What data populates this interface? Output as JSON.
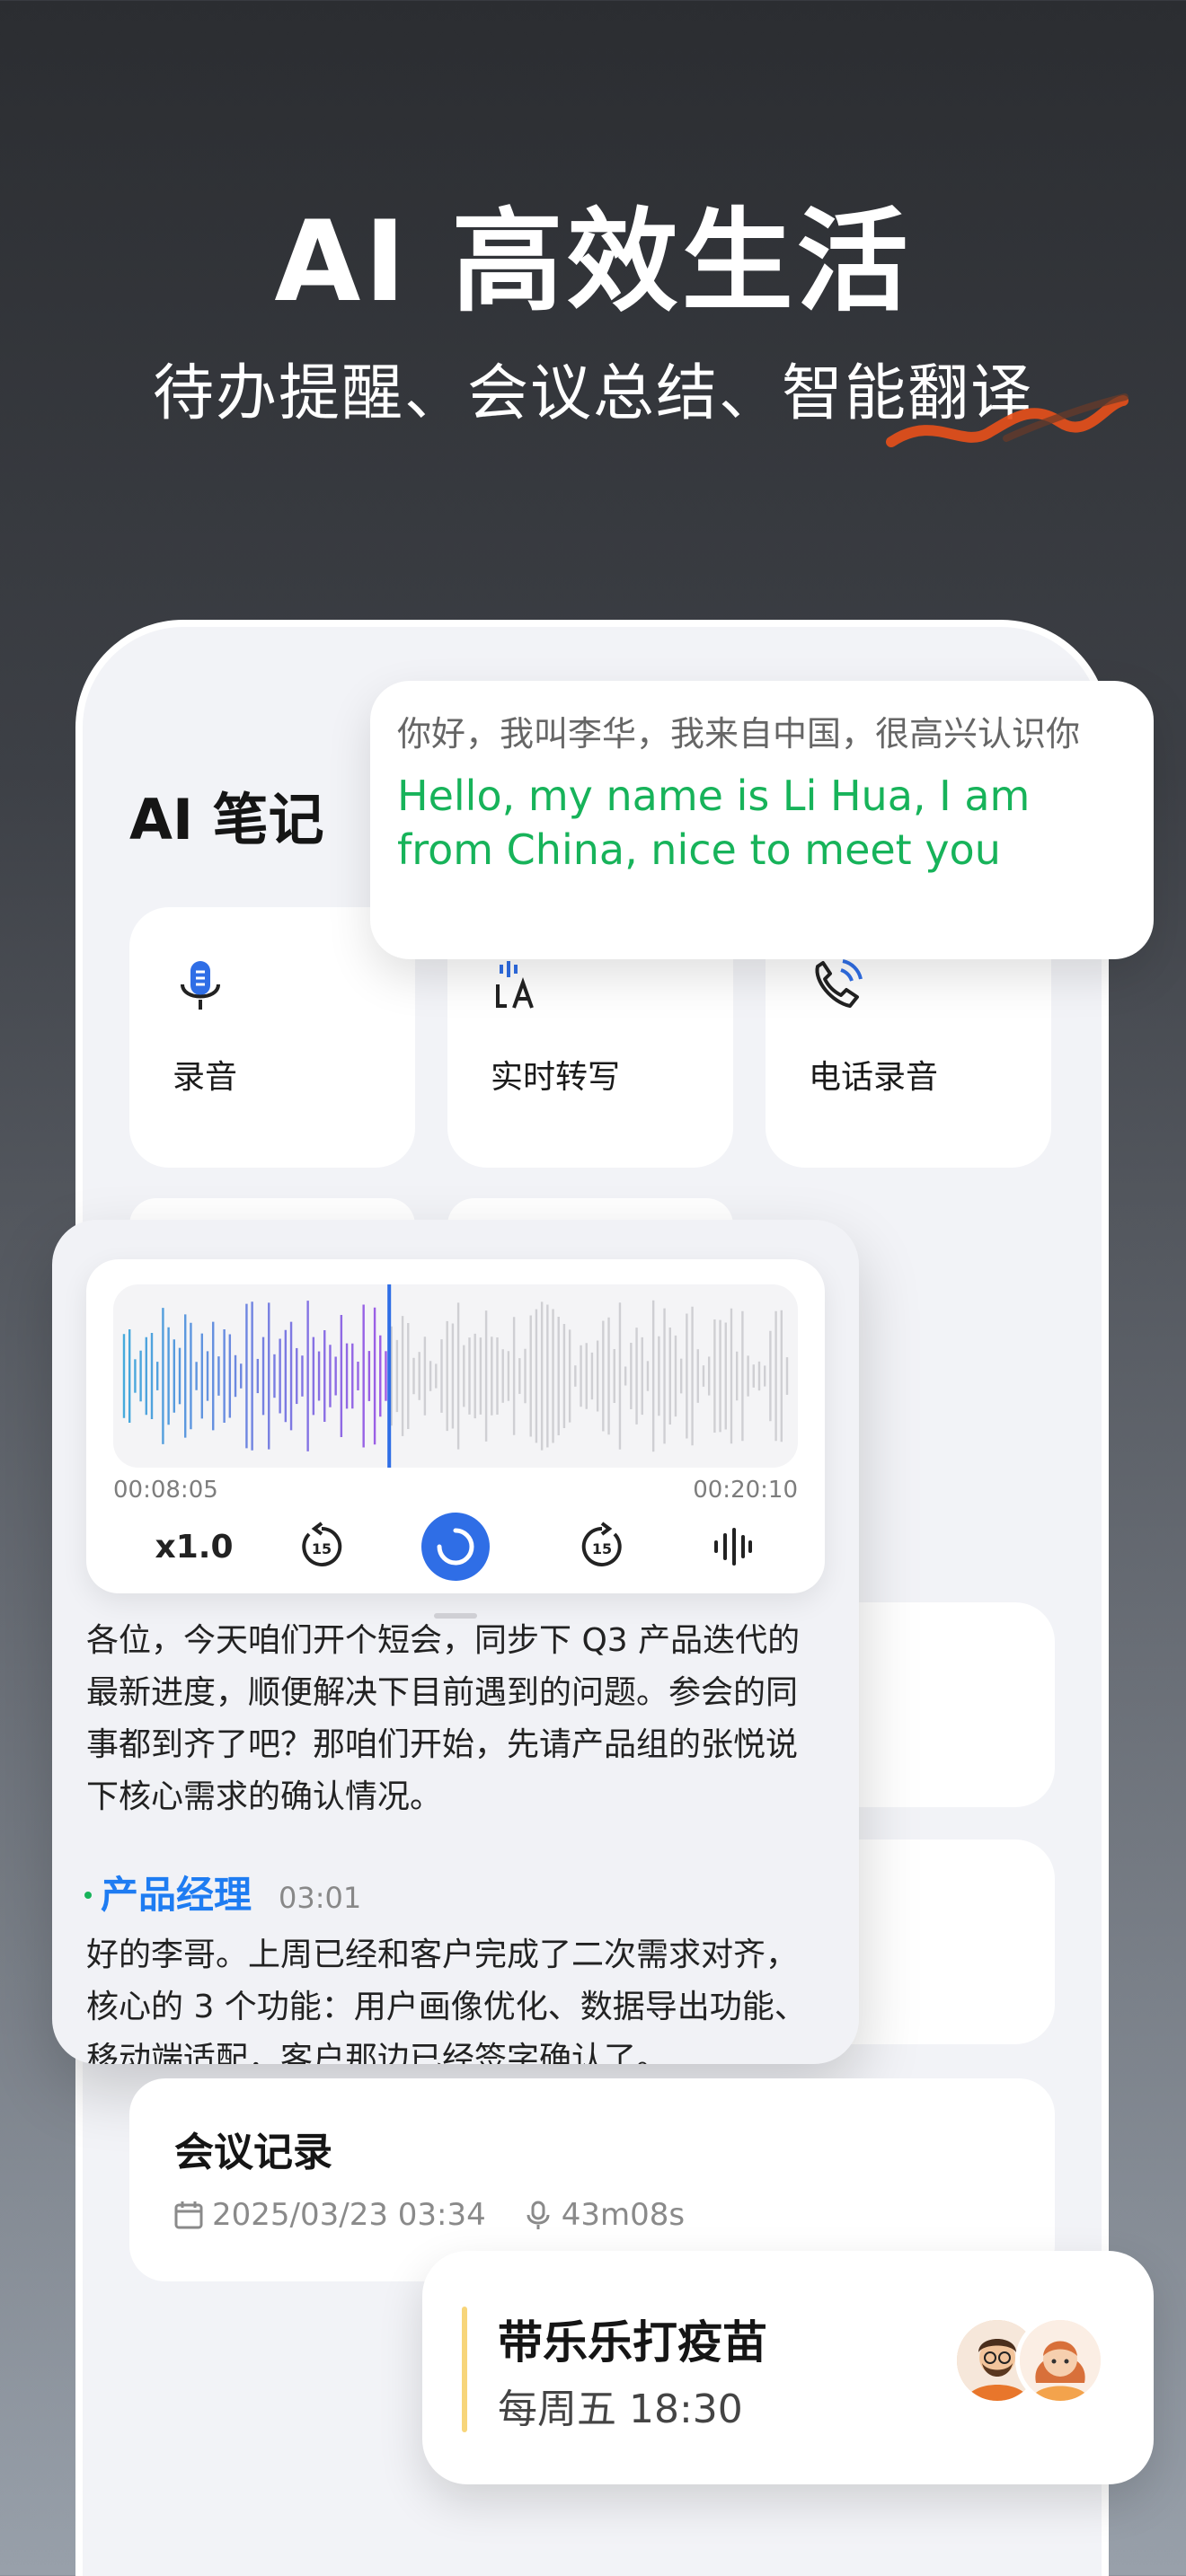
{
  "hero": {
    "title": "AI 高效生活",
    "subtitle": "待办提醒、会议总结、智能翻译"
  },
  "notes": {
    "title": "AI 笔记",
    "features": [
      {
        "label": "录音",
        "icon": "microphone-icon"
      },
      {
        "label": "实时转写",
        "icon": "transcribe-icon"
      },
      {
        "label": "电话录音",
        "icon": "phone-record-icon"
      }
    ]
  },
  "translation": {
    "source": "你好，我叫李华，我来自中国，很高兴认识你",
    "target": "Hello, my name is Li Hua, I am from China, nice to meet you"
  },
  "player": {
    "current_time": "00:08:05",
    "total_time": "00:20:10",
    "speed": "x1.0",
    "rewind_label": "15",
    "forward_label": "15",
    "progress": 0.4
  },
  "transcript": {
    "first_text": "各位，今天咱们开个短会，同步下 Q3 产品迭代的最新进度，顺便解决下目前遇到的问题。参会的同事都到齐了吧？那咱们开始，先请产品组的张悦说下核心需求的确认情况。",
    "speaker_name": "产品经理",
    "speaker_time": "03:01",
    "second_text": "好的李哥。上周已经和客户完成了二次需求对齐，核心的 3 个功能：用户画像优化、数据导出功能、移动端适配，客户那边已经签字确认了。"
  },
  "meeting": {
    "title": "会议记录",
    "date": "2025/03/23 03:34",
    "duration": "43m08s"
  },
  "reminder": {
    "title": "带乐乐打疫苗",
    "time": "每周五 18:30"
  },
  "colors": {
    "accent_blue": "#2f6ee6",
    "translation_green": "#17b35a",
    "speaker_blue": "#1e7cf2",
    "reminder_bar": "#f7d57a"
  }
}
